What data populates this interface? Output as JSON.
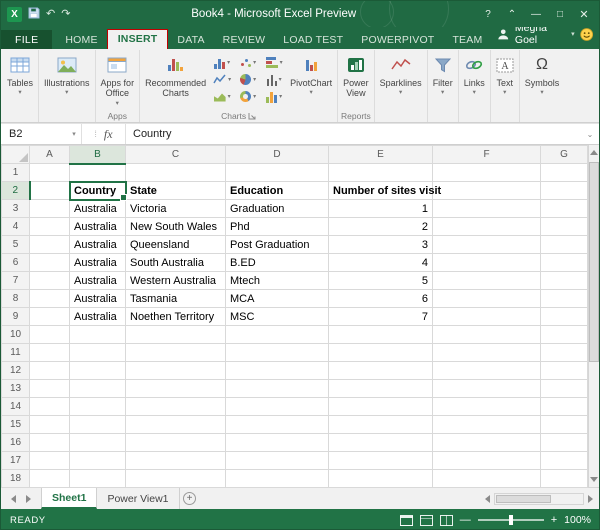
{
  "window": {
    "title": "Book4 - Microsoft Excel Preview",
    "help": "?",
    "ribbon_options": "⌃",
    "minimize": "—",
    "maximize": "□",
    "close": "✕"
  },
  "quick_access": {
    "excel": "X",
    "undo": "↶",
    "redo": "↷"
  },
  "tabbar": {
    "file": "FILE",
    "tabs": [
      "HOME",
      "INSERT",
      "DATA",
      "REVIEW",
      "LOAD TEST",
      "POWERPIVOT",
      "TEAM"
    ],
    "active": "INSERT",
    "user": "Megha Goel",
    "user_dd": "▾"
  },
  "ribbon": {
    "tables": "Tables",
    "illustrations": "Illustrations",
    "apps_line1": "Apps for",
    "apps_line2": "Office",
    "apps_group_label": "Apps",
    "recommended_line1": "Recommended",
    "recommended_line2": "Charts",
    "pivotchart": "PivotChart",
    "charts_group_label": "Charts",
    "power_line1": "Power",
    "power_line2": "View",
    "reports_group_label": "Reports",
    "sparklines": "Sparklines",
    "filter": "Filter",
    "links": "Links",
    "text": "Text",
    "symbols": "Symbols",
    "omega": "Ω",
    "dd": "▾"
  },
  "formula_bar": {
    "name_box": "B2",
    "name_dd": "▾",
    "fx": "fx",
    "content": "Country",
    "chevron": "⌄"
  },
  "sheet": {
    "columns": [
      "A",
      "B",
      "C",
      "D",
      "E",
      "F",
      "G"
    ],
    "selected_column": "B",
    "selected_row": 2,
    "visible_rows": 18,
    "header_row": {
      "row": 2,
      "cols": {
        "B": "Country",
        "C": "State",
        "D": "Education",
        "E": "Number of sites visit"
      }
    },
    "data_rows": [
      {
        "row": 3,
        "B": "Australia",
        "C": "Victoria",
        "D": "Graduation",
        "E": "1"
      },
      {
        "row": 4,
        "B": "Australia",
        "C": "New South Wales",
        "D": "Phd",
        "E": "2"
      },
      {
        "row": 5,
        "B": "Australia",
        "C": "Queensland",
        "D": "Post Graduation",
        "E": "3"
      },
      {
        "row": 6,
        "B": "Australia",
        "C": "South Australia",
        "D": "B.ED",
        "E": "4"
      },
      {
        "row": 7,
        "B": "Australia",
        "C": "Western Australia",
        "D": "Mtech",
        "E": "5"
      },
      {
        "row": 8,
        "B": "Australia",
        "C": "Tasmania",
        "D": "MCA",
        "E": "6"
      },
      {
        "row": 9,
        "B": "Australia",
        "C": "Noethen Territory",
        "D": "MSC",
        "E": "7"
      }
    ]
  },
  "sheet_tabs": {
    "tabs": [
      {
        "label": "Sheet1",
        "active": true
      },
      {
        "label": "Power View1",
        "active": false
      }
    ],
    "add": "+"
  },
  "status_bar": {
    "mode": "READY",
    "zoom_out": "—",
    "zoom_in": "+",
    "zoom": "100%"
  },
  "colors": {
    "accent_green": "#217346",
    "titlebar_green": "#206a43",
    "annotation_red": "#c00000"
  }
}
